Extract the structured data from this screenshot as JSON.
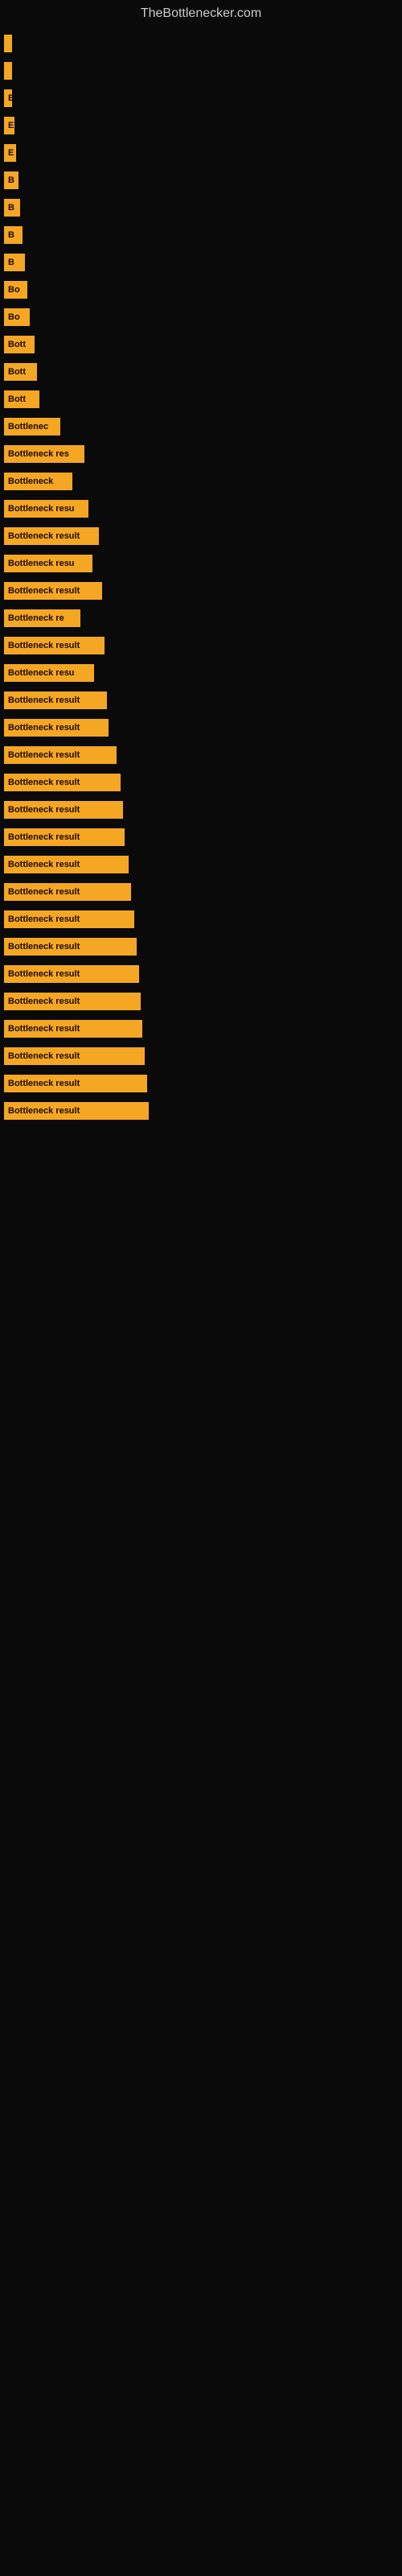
{
  "site": {
    "title": "TheBottlenecker.com"
  },
  "bars": [
    {
      "id": 1,
      "label": "",
      "width": 3
    },
    {
      "id": 2,
      "label": "",
      "width": 3
    },
    {
      "id": 3,
      "label": "E",
      "width": 10
    },
    {
      "id": 4,
      "label": "E",
      "width": 13
    },
    {
      "id": 5,
      "label": "E",
      "width": 15
    },
    {
      "id": 6,
      "label": "B",
      "width": 18
    },
    {
      "id": 7,
      "label": "B",
      "width": 20
    },
    {
      "id": 8,
      "label": "B",
      "width": 23
    },
    {
      "id": 9,
      "label": "B",
      "width": 26
    },
    {
      "id": 10,
      "label": "Bo",
      "width": 29
    },
    {
      "id": 11,
      "label": "Bo",
      "width": 32
    },
    {
      "id": 12,
      "label": "Bott",
      "width": 38
    },
    {
      "id": 13,
      "label": "Bott",
      "width": 41
    },
    {
      "id": 14,
      "label": "Bott",
      "width": 44
    },
    {
      "id": 15,
      "label": "Bottlenec",
      "width": 70
    },
    {
      "id": 16,
      "label": "Bottleneck res",
      "width": 100
    },
    {
      "id": 17,
      "label": "Bottleneck",
      "width": 85
    },
    {
      "id": 18,
      "label": "Bottleneck resu",
      "width": 105
    },
    {
      "id": 19,
      "label": "Bottleneck result",
      "width": 118
    },
    {
      "id": 20,
      "label": "Bottleneck resu",
      "width": 110
    },
    {
      "id": 21,
      "label": "Bottleneck result",
      "width": 122
    },
    {
      "id": 22,
      "label": "Bottleneck re",
      "width": 95
    },
    {
      "id": 23,
      "label": "Bottleneck result",
      "width": 125
    },
    {
      "id": 24,
      "label": "Bottleneck resu",
      "width": 112
    },
    {
      "id": 25,
      "label": "Bottleneck result",
      "width": 128
    },
    {
      "id": 26,
      "label": "Bottleneck result",
      "width": 130
    },
    {
      "id": 27,
      "label": "Bottleneck result",
      "width": 140
    },
    {
      "id": 28,
      "label": "Bottleneck result",
      "width": 145
    },
    {
      "id": 29,
      "label": "Bottleneck result",
      "width": 148
    },
    {
      "id": 30,
      "label": "Bottleneck result",
      "width": 150
    },
    {
      "id": 31,
      "label": "Bottleneck result",
      "width": 155
    },
    {
      "id": 32,
      "label": "Bottleneck result",
      "width": 158
    },
    {
      "id": 33,
      "label": "Bottleneck result",
      "width": 162
    },
    {
      "id": 34,
      "label": "Bottleneck result",
      "width": 165
    },
    {
      "id": 35,
      "label": "Bottleneck result",
      "width": 168
    },
    {
      "id": 36,
      "label": "Bottleneck result",
      "width": 170
    },
    {
      "id": 37,
      "label": "Bottleneck result",
      "width": 172
    },
    {
      "id": 38,
      "label": "Bottleneck result",
      "width": 175
    },
    {
      "id": 39,
      "label": "Bottleneck result",
      "width": 178
    },
    {
      "id": 40,
      "label": "Bottleneck result",
      "width": 180
    }
  ]
}
